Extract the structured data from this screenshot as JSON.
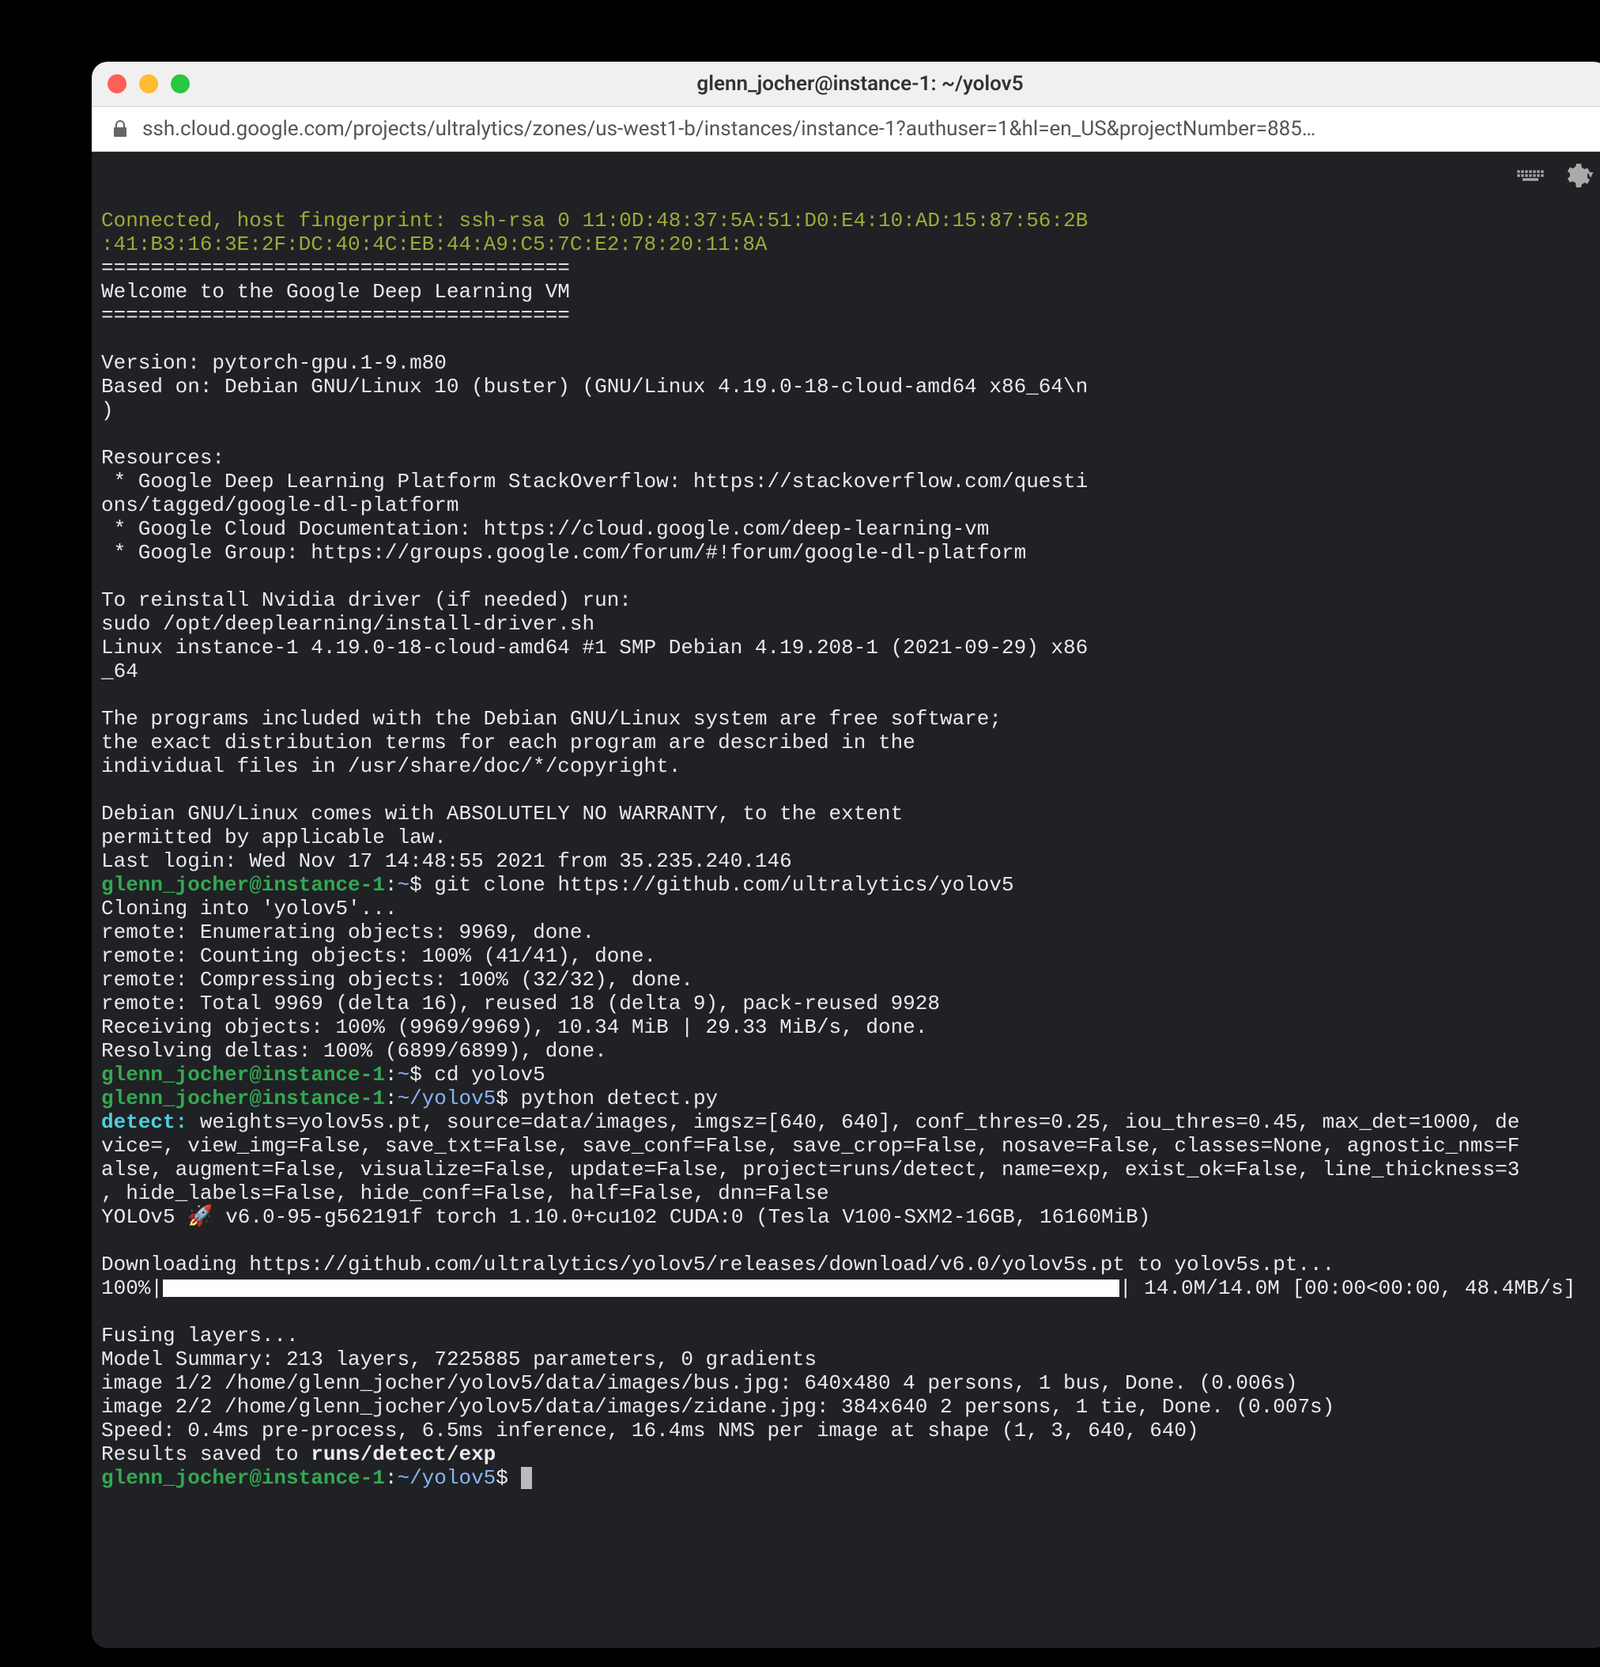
{
  "window": {
    "title": "glenn_jocher@instance-1: ~/yolov5",
    "url_display": "ssh.cloud.google.com/projects/ultralytics/zones/us-west1-b/instances/instance-1?authuser=1&hl=en_US&projectNumber=885…"
  },
  "term": {
    "fp1": "Connected, host fingerprint: ssh-rsa 0 11:0D:48:37:5A:51:D0:E4:10:AD:15:87:56:2B",
    "fp2": ":41:B3:16:3E:2F:DC:40:4C:EB:44:A9:C5:7C:E2:78:20:11:8A",
    "hr": "======================================",
    "welcome": "Welcome to the Google Deep Learning VM",
    "ver": "Version: pytorch-gpu.1-9.m80",
    "based": "Based on: Debian GNU/Linux 10 (buster) (GNU/Linux 4.19.0-18-cloud-amd64 x86_64\\n",
    "paren": ")",
    "res_h": "Resources:",
    "res1a": " * Google Deep Learning Platform StackOverflow: https://stackoverflow.com/questi",
    "res1b": "ons/tagged/google-dl-platform",
    "res2": " * Google Cloud Documentation: https://cloud.google.com/deep-learning-vm",
    "res3": " * Google Group: https://groups.google.com/forum/#!forum/google-dl-platform",
    "reinst": "To reinstall Nvidia driver (if needed) run:",
    "sudo": "sudo /opt/deeplearning/install-driver.sh",
    "linux1": "Linux instance-1 4.19.0-18-cloud-amd64 #1 SMP Debian 4.19.208-1 (2021-09-29) x86",
    "linux2": "_64",
    "free1": "The programs included with the Debian GNU/Linux system are free software;",
    "free2": "the exact distribution terms for each program are described in the",
    "free3": "individual files in /usr/share/doc/*/copyright.",
    "warr1": "Debian GNU/Linux comes with ABSOLUTELY NO WARRANTY, to the extent",
    "warr2": "permitted by applicable law.",
    "last": "Last login: Wed Nov 17 14:48:55 2021 from 35.235.240.146",
    "prompt_user": "glenn_jocher@instance-1",
    "tilde": "~",
    "path2": "~/yolov5",
    "cmd1": "git clone https://github.com/ultralytics/yolov5",
    "clone1": "Cloning into 'yolov5'...",
    "clone2": "remote: Enumerating objects: 9969, done.",
    "clone3": "remote: Counting objects: 100% (41/41), done.",
    "clone4": "remote: Compressing objects: 100% (32/32), done.",
    "clone5": "remote: Total 9969 (delta 16), reused 18 (delta 9), pack-reused 9928",
    "clone6": "Receiving objects: 100% (9969/9969), 10.34 MiB | 29.33 MiB/s, done.",
    "clone7": "Resolving deltas: 100% (6899/6899), done.",
    "cmd2": "cd yolov5",
    "cmd3": "python detect.py",
    "detect_label": "detect: ",
    "detect1": "weights=yolov5s.pt, source=data/images, imgsz=[640, 640], conf_thres=0.25, iou_thres=0.45, max_det=1000, de",
    "detect2": "vice=, view_img=False, save_txt=False, save_conf=False, save_crop=False, nosave=False, classes=None, agnostic_nms=F",
    "detect3": "alse, augment=False, visualize=False, update=False, project=runs/detect, name=exp, exist_ok=False, line_thickness=3",
    "detect4": ", hide_labels=False, hide_conf=False, half=False, dnn=False",
    "yolo_line": "YOLOv5 🚀 v6.0-95-g562191f torch 1.10.0+cu102 CUDA:0 (Tesla V100-SXM2-16GB, 16160MiB)",
    "dl": "Downloading https://github.com/ultralytics/yolov5/releases/download/v6.0/yolov5s.pt to yolov5s.pt...",
    "pct": "100%|",
    "pct_tail": "| 14.0M/14.0M [00:00<00:00, 48.4MB/s]",
    "fuse": "Fusing layers... ",
    "model": "Model Summary: 213 layers, 7225885 parameters, 0 gradients",
    "img1": "image 1/2 /home/glenn_jocher/yolov5/data/images/bus.jpg: 640x480 4 persons, 1 bus, Done. (0.006s)",
    "img2": "image 2/2 /home/glenn_jocher/yolov5/data/images/zidane.jpg: 384x640 2 persons, 1 tie, Done. (0.007s)",
    "speed": "Speed: 0.4ms pre-process, 6.5ms inference, 16.4ms NMS per image at shape (1, 3, 640, 640)",
    "saved_pre": "Results saved to ",
    "saved_path": "runs/detect/exp"
  }
}
